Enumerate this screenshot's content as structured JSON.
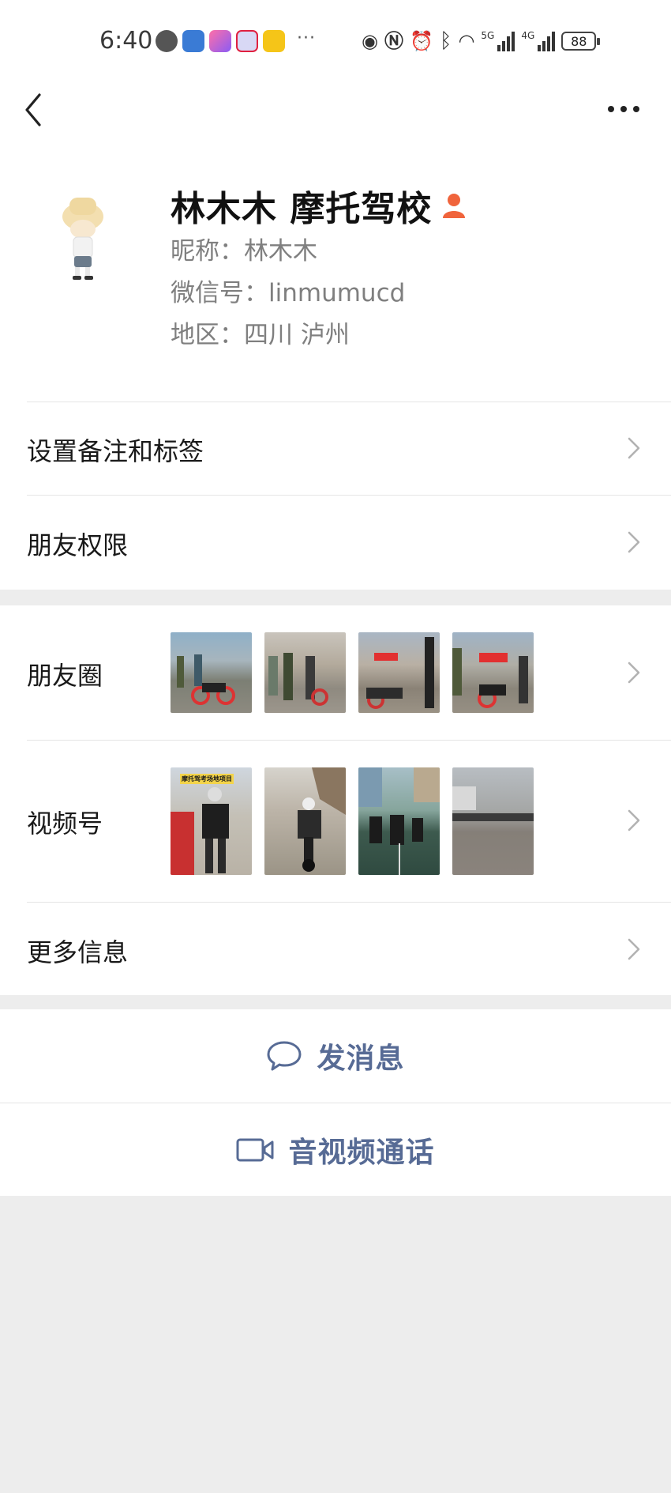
{
  "status_bar": {
    "time": "6:40",
    "more_notifications": "···",
    "network_1": "5G",
    "network_2": "4G",
    "battery": "88"
  },
  "profile": {
    "display_name": "林木木 摩托驾校",
    "nickname": "昵称：林木木",
    "wechat_id": "微信号：linmumucd",
    "region": "地区：四川  泸州"
  },
  "menu": {
    "set_remark": "设置备注和标签",
    "friend_permissions": "朋友权限",
    "moments": "朋友圈",
    "channels": "视频号",
    "channels_thumb_caption": "摩托驾考场地项目",
    "more_info": "更多信息"
  },
  "actions": {
    "send_message": "发消息",
    "av_call": "音视频通话"
  },
  "colors": {
    "link_blue": "#576b95",
    "page_gray": "#ededed",
    "person_icon": "#f0643c"
  }
}
